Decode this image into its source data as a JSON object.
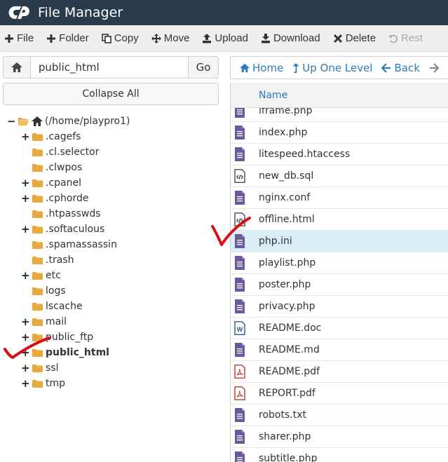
{
  "header": {
    "title": "File Manager",
    "logo_icon": "cpanel-logo-icon"
  },
  "toolbar": {
    "items": [
      {
        "label": "File",
        "icon": "plus-icon"
      },
      {
        "label": "Folder",
        "icon": "plus-icon"
      },
      {
        "label": "Copy",
        "icon": "copy-icon"
      },
      {
        "label": "Move",
        "icon": "move-icon"
      },
      {
        "label": "Upload",
        "icon": "upload-icon"
      },
      {
        "label": "Download",
        "icon": "download-icon"
      },
      {
        "label": "Delete",
        "icon": "close-icon"
      },
      {
        "label": "Rest",
        "icon": "restore-icon"
      }
    ]
  },
  "path_bar": {
    "value": "public_html",
    "go_label": "Go"
  },
  "collapse_label": "Collapse All",
  "tree": {
    "root": "(/home/playpro1)",
    "items": [
      {
        "name": ".cagefs",
        "expandable": true
      },
      {
        "name": ".cl.selector",
        "expandable": false
      },
      {
        "name": ".clwpos",
        "expandable": false
      },
      {
        "name": ".cpanel",
        "expandable": true
      },
      {
        "name": ".cphorde",
        "expandable": true
      },
      {
        "name": ".htpasswds",
        "expandable": false
      },
      {
        "name": ".softaculous",
        "expandable": true
      },
      {
        "name": ".spamassassin",
        "expandable": false
      },
      {
        "name": ".trash",
        "expandable": false
      },
      {
        "name": "etc",
        "expandable": true
      },
      {
        "name": "logs",
        "expandable": false
      },
      {
        "name": "lscache",
        "expandable": false
      },
      {
        "name": "mail",
        "expandable": true
      },
      {
        "name": "public_ftp",
        "expandable": true
      },
      {
        "name": "public_html",
        "expandable": true,
        "current": true
      },
      {
        "name": "ssl",
        "expandable": true
      },
      {
        "name": "tmp",
        "expandable": true
      }
    ]
  },
  "nav": {
    "home": "Home",
    "up": "Up One Level",
    "back": "Back"
  },
  "list": {
    "column_name": "Name",
    "files": [
      {
        "name": "iframe.php",
        "type": "text"
      },
      {
        "name": "index.php",
        "type": "text"
      },
      {
        "name": "litespeed.htaccess",
        "type": "text"
      },
      {
        "name": "new_db.sql",
        "type": "code"
      },
      {
        "name": "nginx.conf",
        "type": "text"
      },
      {
        "name": "offline.html",
        "type": "code"
      },
      {
        "name": "php.ini",
        "type": "text",
        "selected": true
      },
      {
        "name": "playlist.php",
        "type": "text"
      },
      {
        "name": "poster.php",
        "type": "text"
      },
      {
        "name": "privacy.php",
        "type": "text"
      },
      {
        "name": "README.doc",
        "type": "word"
      },
      {
        "name": "README.md",
        "type": "text"
      },
      {
        "name": "README.pdf",
        "type": "pdf"
      },
      {
        "name": "REPORT.pdf",
        "type": "pdf"
      },
      {
        "name": "robots.txt",
        "type": "text"
      },
      {
        "name": "sharer.php",
        "type": "text"
      },
      {
        "name": "subtitle.php",
        "type": "text"
      }
    ]
  },
  "colors": {
    "header_bg": "#293a4a",
    "link": "#2d7bbb",
    "folder": "#e8a93a",
    "selected_row": "#d9edf7",
    "annotation": "#d9101a"
  }
}
